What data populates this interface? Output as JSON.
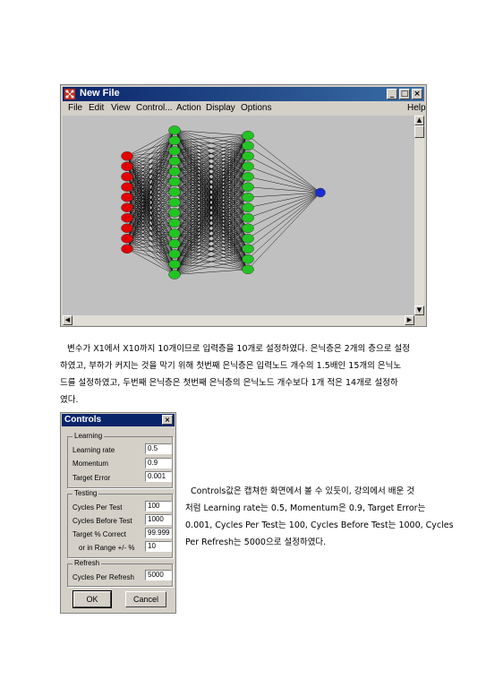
{
  "window": {
    "title": "New File",
    "menu": [
      "File",
      "Edit",
      "View",
      "Control...",
      "Action",
      "Display",
      "Options",
      "Help"
    ],
    "colors": {
      "input": "#e30000",
      "hidden": "#22c422",
      "output": "#1a2bd8",
      "canvas": "#c0c0c0",
      "titlebar": "#0a246a"
    },
    "network": {
      "input_nodes": 10,
      "hidden1_nodes": 15,
      "hidden2_nodes": 14,
      "output_nodes": 1
    }
  },
  "paragraph": [
    "변수가 X1에서 X10까지 10개이므로 입력층을 10개로 설정하였다. 은닉층은 2개의 층으로 설정",
    "하였고, 부하가 커지는 것을 막기 위해 첫번째 은닉층은 입력노드 개수의 1.5배인 15개의 은닉노",
    "드를 설정하였고, 두번째 은닉층은 첫번째 은닉층의 은닉노드 개수보다 1개 적은 14개로 설정하",
    "였다."
  ],
  "controls": {
    "title": "Controls",
    "learning": {
      "label": "Learning",
      "rate_label": "Learning rate",
      "rate": "0.5",
      "momentum_label": "Momentum",
      "momentum": "0.9",
      "target_error_label": "Target Error",
      "target_error": "0.001"
    },
    "testing": {
      "label": "Testing",
      "cycles_per_test_label": "Cycles Per Test",
      "cycles_per_test": "100",
      "cycles_before_test_label": "Cycles Before Test",
      "cycles_before_test": "1000",
      "target_correct_label": "Target % Correct",
      "target_correct": "99.999",
      "range_label": "or in Range +/- %",
      "range": "10"
    },
    "refresh": {
      "label": "Refresh",
      "cycles_per_refresh_label": "Cycles Per Refresh",
      "cycles_per_refresh": "5000"
    },
    "ok_label": "OK",
    "cancel_label": "Cancel"
  },
  "side_text": [
    "Controls값은 캡쳐한 화면에서 볼 수 있듯이, 강의에서 배운 것",
    "처럼 Learning rate는 0.5, Momentum은 0.9, Target Error는",
    "0.001, Cycles Per Test는 100, Cycles Before Test는 1000, Cycles",
    "Per Refresh는 5000으로 설정하였다."
  ]
}
